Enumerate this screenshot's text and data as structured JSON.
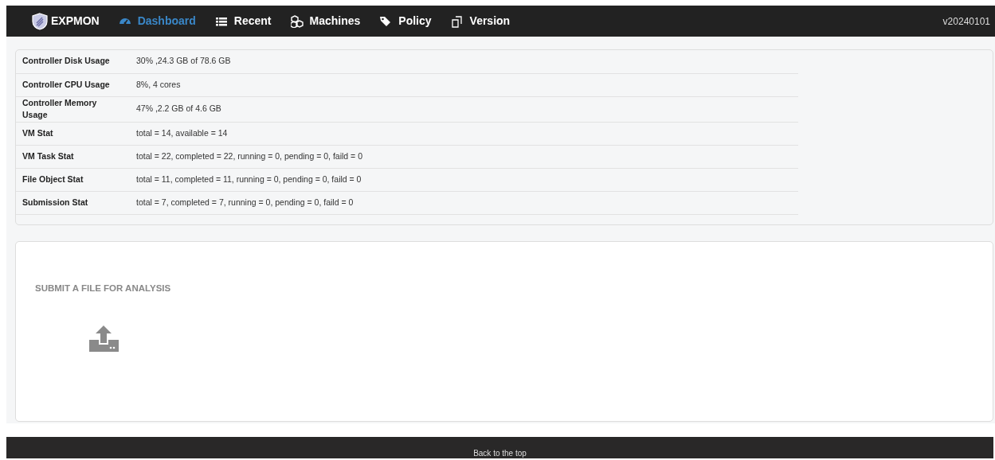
{
  "navbar": {
    "brand": "EXPMON",
    "items": [
      {
        "label": "Dashboard",
        "kind": "dashboard",
        "selected": true
      },
      {
        "label": "Recent",
        "kind": "list",
        "selected": false
      },
      {
        "label": "Machines",
        "kind": "machines",
        "selected": false
      },
      {
        "label": "Policy",
        "kind": "tags",
        "selected": false
      },
      {
        "label": "Version",
        "kind": "version",
        "selected": false
      }
    ],
    "version": "v20240101"
  },
  "stats": [
    {
      "label": "Controller Disk Usage",
      "value": "30% ,24.3 GB of 78.6 GB"
    },
    {
      "label": "Controller CPU Usage",
      "value": "8%, 4 cores"
    },
    {
      "label": "Controller Memory Usage",
      "value": "47% ,2.2 GB of 4.6 GB"
    },
    {
      "label": "VM Stat",
      "value": "total = 14, available = 14"
    },
    {
      "label": "VM Task Stat",
      "value": "total = 22, completed = 22, running = 0, pending = 0, faild = 0"
    },
    {
      "label": "File Object Stat",
      "value": "total = 11, completed = 11, running = 0, pending = 0, faild = 0"
    },
    {
      "label": "Submission Stat",
      "value": "total = 7, completed = 7, running = 0, pending = 0, faild = 0"
    }
  ],
  "submit": {
    "title": "SUBMIT A FILE FOR ANALYSIS"
  },
  "footer": {
    "link": "Back to the top"
  }
}
